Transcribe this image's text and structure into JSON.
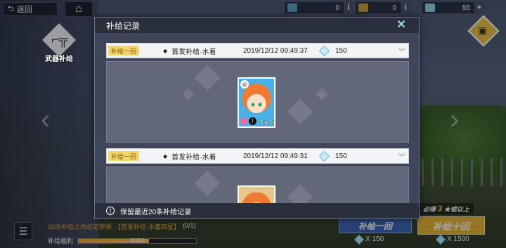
{
  "topbar": {
    "back_label": "返回",
    "resources": [
      {
        "name": "resource-1",
        "value": "0",
        "color": "#5aa4c8"
      },
      {
        "name": "resource-2",
        "value": "0",
        "color": "#c8a04a"
      },
      {
        "name": "resource-3",
        "value": "55",
        "color": "#8fd6ee"
      }
    ]
  },
  "left_tab": {
    "label": "武器补给"
  },
  "dialog": {
    "title": "补给记录",
    "footer_text": "保留最近20条补给记录",
    "records": [
      {
        "type": "补给一回",
        "pool": "首发补给·水着",
        "time": "2019/12/12 09:49:37",
        "cost": "150",
        "card_level": "Lv.1"
      },
      {
        "type": "补给一回",
        "pool": "首发补给·水着",
        "time": "2019/12/12 09:49:31",
        "cost": "150",
        "card_level": ""
      }
    ]
  },
  "bottom": {
    "info_prefix": "20次补给之内必定获得",
    "info_highlight": "【首发补给·水着四星】",
    "info_count": "(0/1)",
    "welfare_label": "补给福利",
    "welfare_progress_text": "30/50",
    "welfare_progress": 0.6,
    "guarantee_prefix": "必得",
    "guarantee_num": "3",
    "guarantee_suffix": "★或以上",
    "pull_one_label": "补给一回",
    "pull_ten_label": "补给十回",
    "pull_one_cost": "X 150",
    "pull_ten_cost": "X 1500"
  },
  "colors": {
    "accent_yellow": "#e7b43a",
    "accent_blue": "#3f66b6",
    "record_tag": "#f4d66e"
  }
}
